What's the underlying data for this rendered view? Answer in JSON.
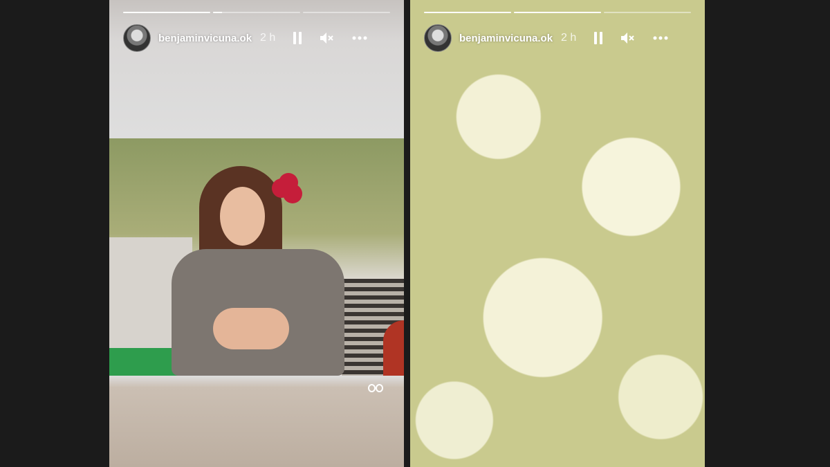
{
  "stories": [
    {
      "username": "benjaminvicuna.ok",
      "time": "2 h",
      "progress": [
        1.0,
        0.1,
        0.0
      ],
      "icons": {
        "pause": "pause-icon",
        "mute": "mute-icon",
        "more": "more-icon",
        "boomerang": "boomerang-icon"
      }
    },
    {
      "username": "benjaminvicuna.ok",
      "time": "2 h",
      "progress": [
        1.0,
        1.0,
        0.0
      ],
      "icons": {
        "pause": "pause-icon",
        "mute": "mute-icon",
        "more": "more-icon"
      }
    }
  ],
  "colors": {
    "background": "#1b1b1b",
    "text": "#ffffff"
  }
}
